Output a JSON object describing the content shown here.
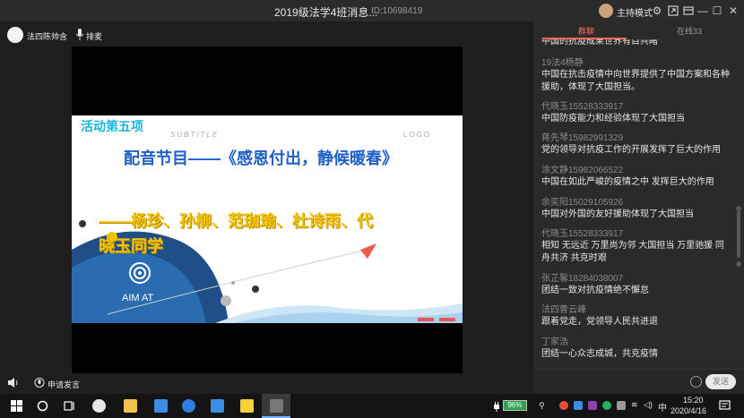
{
  "window": {
    "title": "2019级法学4班消息...",
    "room_id": "ID:10698419",
    "host_mode": "主持模式"
  },
  "presenter": {
    "name": "法四陈帅含",
    "mic_label": "排麦"
  },
  "slide": {
    "activity_label": "活动第五项",
    "subtitle_word": "SUBTITLE",
    "logo_word": "LOGO",
    "headline": "配音节目——《感恩付出，静候暖春》",
    "names_line1": "——杨珍、孙柳、范珈瑜、杜诗雨、代",
    "names_line2": "晓玉同学",
    "aim_label": "AIM AT"
  },
  "bottom_bar": {
    "request_label": "申请发言"
  },
  "chat": {
    "tabs": [
      {
        "label": "群聊",
        "active": true
      },
      {
        "label": "在线33",
        "active": false
      }
    ],
    "cut_message": "中国的抗疫成果世界有目共睹",
    "messages": [
      {
        "sender": "19法4杨静",
        "text": "中国在抗击疫情中向世界提供了中国方案和各种援助，体现了大国担当。"
      },
      {
        "sender": "代晓玉15528333917",
        "text": "中国防疫能力和经验体现了大国担当"
      },
      {
        "sender": "蒋先琴15982991329",
        "text": "党的领导对抗疫工作的开展发挥了巨大的作用"
      },
      {
        "sender": "涂文静15982066522",
        "text": "中国在如此严峻的疫情之中 发挥巨大的作用"
      },
      {
        "sender": "余奕阳15029105926",
        "text": "中国对外国的友好援助体现了大国担当"
      },
      {
        "sender": "代晓玉15528333917",
        "text": "相知 无远近 万里尚为邻 大国担当 万里驰援 同舟共济 共克时艰"
      },
      {
        "sender": "张芷馨18284038007",
        "text": "团结一致对抗疫情绝不懈怠"
      },
      {
        "sender": "法四曹云峰",
        "text": "跟着党走，党领导人民共进退"
      },
      {
        "sender": "丁家浩",
        "text": "团结一心众志成城，共克疫情"
      }
    ],
    "send_label": "发送"
  },
  "taskbar": {
    "battery": "96%",
    "ime": "中",
    "time": "15:20",
    "date": "2020/4/16"
  },
  "colors": {
    "accent": "#ff6d5a",
    "headline": "#1f5fc8",
    "names": "#f2c100",
    "activity": "#19b6e0"
  }
}
